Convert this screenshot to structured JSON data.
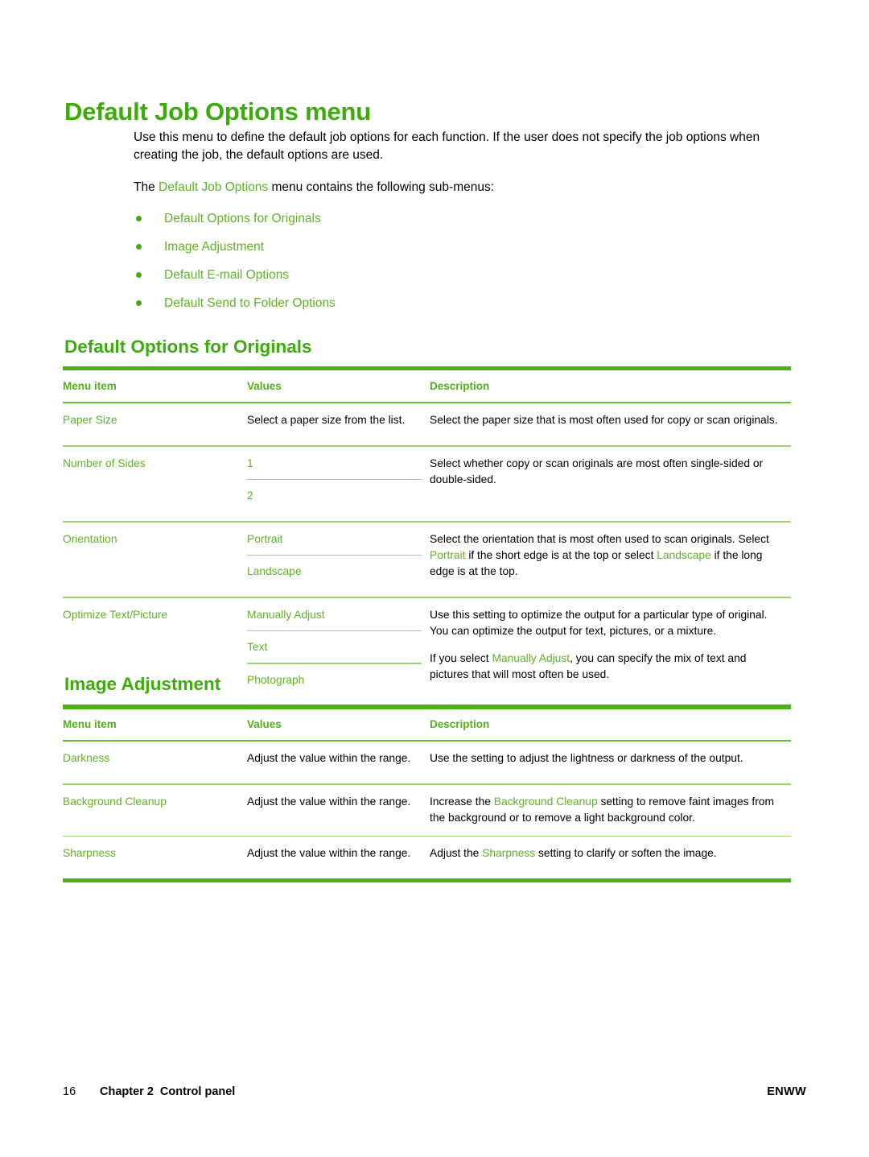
{
  "document": {
    "title": "Default Job Options menu",
    "intro_paragraph": "Use this menu to define the default job options for each function. If the user does not specify the job options when creating the job, the default options are used.",
    "submenu_intro": {
      "before": "The ",
      "link": "Default Job Options",
      "after": " menu contains the following sub-menus:"
    },
    "submenu_list": [
      {
        "label": "Default Options for Originals"
      },
      {
        "label": "Image Adjustment"
      },
      {
        "label": "Default E-mail Options"
      },
      {
        "label": "Default Send to Folder Options"
      }
    ]
  },
  "colors": {
    "heading_green": "#3DAA0E",
    "link_green": "#5FB324",
    "rule_thick": "#4CB018",
    "rule_thin": "#6ABF2E",
    "rule_row": "#9BD36E"
  },
  "sections": [
    {
      "heading": "Default Options for Originals",
      "table": {
        "headers": {
          "menu_item": "Menu item",
          "values": "Values",
          "description": "Description"
        },
        "rows": [
          {
            "menu_item": "Paper Size",
            "values": [
              "Select a paper size from the list."
            ],
            "values_style": "neutral",
            "description_parts": [
              [
                {
                  "t": "Select the paper size that is most often used for copy or scan originals.",
                  "link": false
                }
              ]
            ]
          },
          {
            "menu_item": "Number of Sides",
            "values": [
              "1",
              "2"
            ],
            "values_style": "link",
            "description_parts": [
              [
                {
                  "t": "Select whether copy or scan originals are most often single-sided or double-sided.",
                  "link": false
                }
              ]
            ]
          },
          {
            "menu_item": "Orientation",
            "values": [
              "Portrait",
              "Landscape"
            ],
            "values_style": "link",
            "description_parts": [
              [
                {
                  "t": "Select the orientation that is most often used to scan originals. Select ",
                  "link": false
                },
                {
                  "t": "Portrait",
                  "link": true
                },
                {
                  "t": " if the short edge is at the top or select ",
                  "link": false
                },
                {
                  "t": "Landscape",
                  "link": true
                },
                {
                  "t": " if the long edge is at the top.",
                  "link": false
                }
              ]
            ]
          },
          {
            "menu_item": "Optimize Text/Picture",
            "values": [
              "Manually Adjust",
              "Text",
              "Photograph"
            ],
            "values_style": "link",
            "description_parts": [
              [
                {
                  "t": "Use this setting to optimize the output for a particular type of original. You can optimize the output for text, pictures, or a mixture.",
                  "link": false
                }
              ],
              [
                {
                  "t": "If you select ",
                  "link": false
                },
                {
                  "t": "Manually Adjust",
                  "link": true
                },
                {
                  "t": ", you can specify the mix of text and pictures that will most often be used.",
                  "link": false
                }
              ]
            ]
          }
        ]
      }
    },
    {
      "heading": "Image Adjustment",
      "table": {
        "headers": {
          "menu_item": "Menu item",
          "values": "Values",
          "description": "Description"
        },
        "rows": [
          {
            "menu_item": "Darkness",
            "values": [
              "Adjust the value within the range."
            ],
            "values_style": "neutral",
            "description_parts": [
              [
                {
                  "t": "Use the setting to adjust the lightness or darkness of the output.",
                  "link": false
                }
              ]
            ]
          },
          {
            "menu_item": "Background Cleanup",
            "values": [
              "Adjust the value within the range."
            ],
            "values_style": "neutral",
            "description_parts": [
              [
                {
                  "t": "Increase the ",
                  "link": false
                },
                {
                  "t": "Background Cleanup",
                  "link": true
                },
                {
                  "t": " setting to remove faint images from the background or to remove a light background color.",
                  "link": false
                }
              ]
            ]
          },
          {
            "menu_item": "Sharpness",
            "values": [
              "Adjust the value within the range."
            ],
            "values_style": "neutral",
            "description_parts": [
              [
                {
                  "t": "Adjust the ",
                  "link": false
                },
                {
                  "t": "Sharpness",
                  "link": true
                },
                {
                  "t": " setting to clarify or soften the image.",
                  "link": false
                }
              ]
            ]
          }
        ]
      }
    }
  ],
  "footer": {
    "page_number": "16",
    "chapter": "Chapter 2",
    "chapter_title": "Control panel",
    "right_label": "ENWW"
  }
}
